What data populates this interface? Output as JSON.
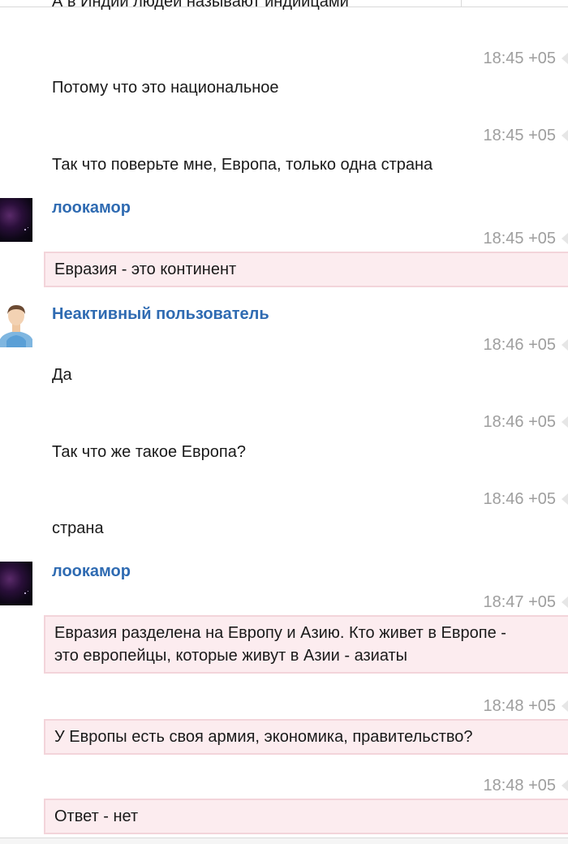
{
  "header": {
    "cut_message": "А в Индии людей называют индийцами"
  },
  "users": {
    "user1": "лоокамор",
    "user2": "Неактивный пользователь"
  },
  "messages": {
    "m1": {
      "time": "18:45 +05",
      "text": "Потому что это национальное"
    },
    "m2": {
      "time": "18:45 +05",
      "text": "Так что поверьте мне, Европа, только одна страна"
    },
    "m3": {
      "time": "18:45 +05",
      "text": "Евразия - это континент"
    },
    "m4": {
      "time": "18:46 +05",
      "text": "Да"
    },
    "m5": {
      "time": "18:46 +05",
      "text": "Так что же такое Европа?"
    },
    "m6": {
      "time": "18:46 +05",
      "text": "страна"
    },
    "m7": {
      "time": "18:47 +05",
      "line1": "Евразия разделена на Европу и Азию. Кто живет в Европе -",
      "line2": "это европейцы, которые живут в Азии - азиаты"
    },
    "m8": {
      "time": "18:48 +05",
      "text": "У Европы есть своя армия, экономика, правительство?"
    },
    "m9": {
      "time": "18:48 +05",
      "text": "Ответ - нет"
    }
  },
  "icons": {
    "avatar_space": "space-nebula-avatar",
    "avatar_user": "default-user-avatar",
    "caret": "message-caret-icon"
  },
  "colors": {
    "author_link": "#2f6bb2",
    "bubble_bg": "#fcecef",
    "bubble_border": "#f3d4da",
    "timestamp": "#9e9e9e"
  }
}
